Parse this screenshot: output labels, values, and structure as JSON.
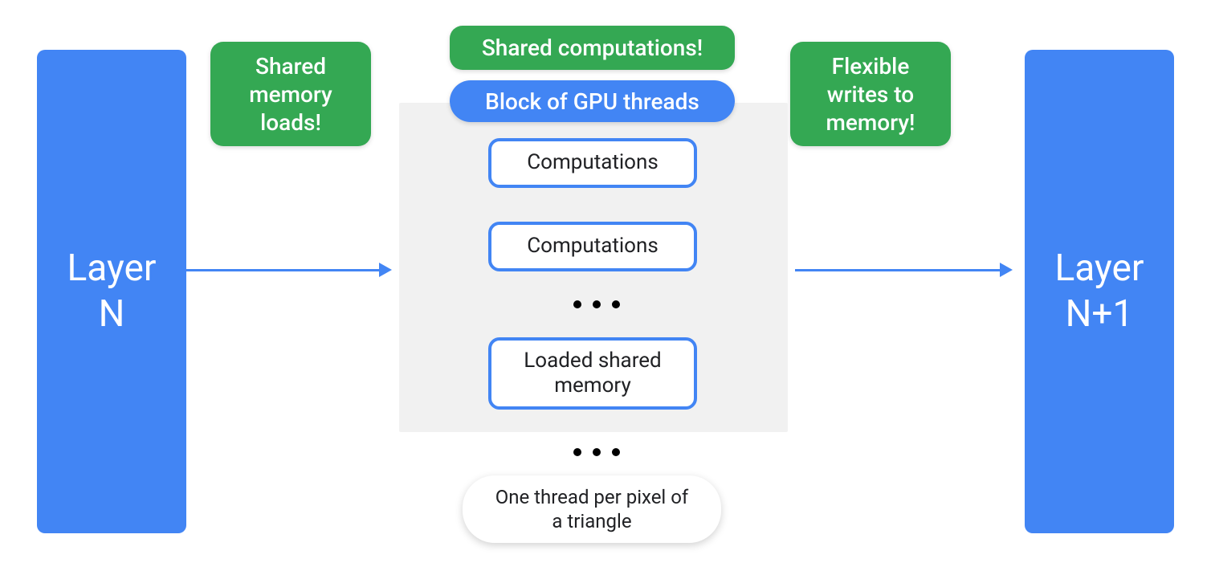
{
  "colors": {
    "blue": "#4285f4",
    "green": "#34a853",
    "panel": "#f1f1f1",
    "text_dark": "#202124"
  },
  "left_layer": {
    "line1": "Layer",
    "line2": "N"
  },
  "right_layer": {
    "line1": "Layer",
    "line2": "N+1"
  },
  "badges": {
    "left": "Shared memory loads!",
    "top": "Shared computations!",
    "right": "Flexible writes to memory!"
  },
  "block_title": "Block of GPU threads",
  "inner_boxes": {
    "b1": "Computations",
    "b2": "Computations",
    "b3": "Loaded shared memory"
  },
  "caption": "One thread per pixel of a triangle"
}
